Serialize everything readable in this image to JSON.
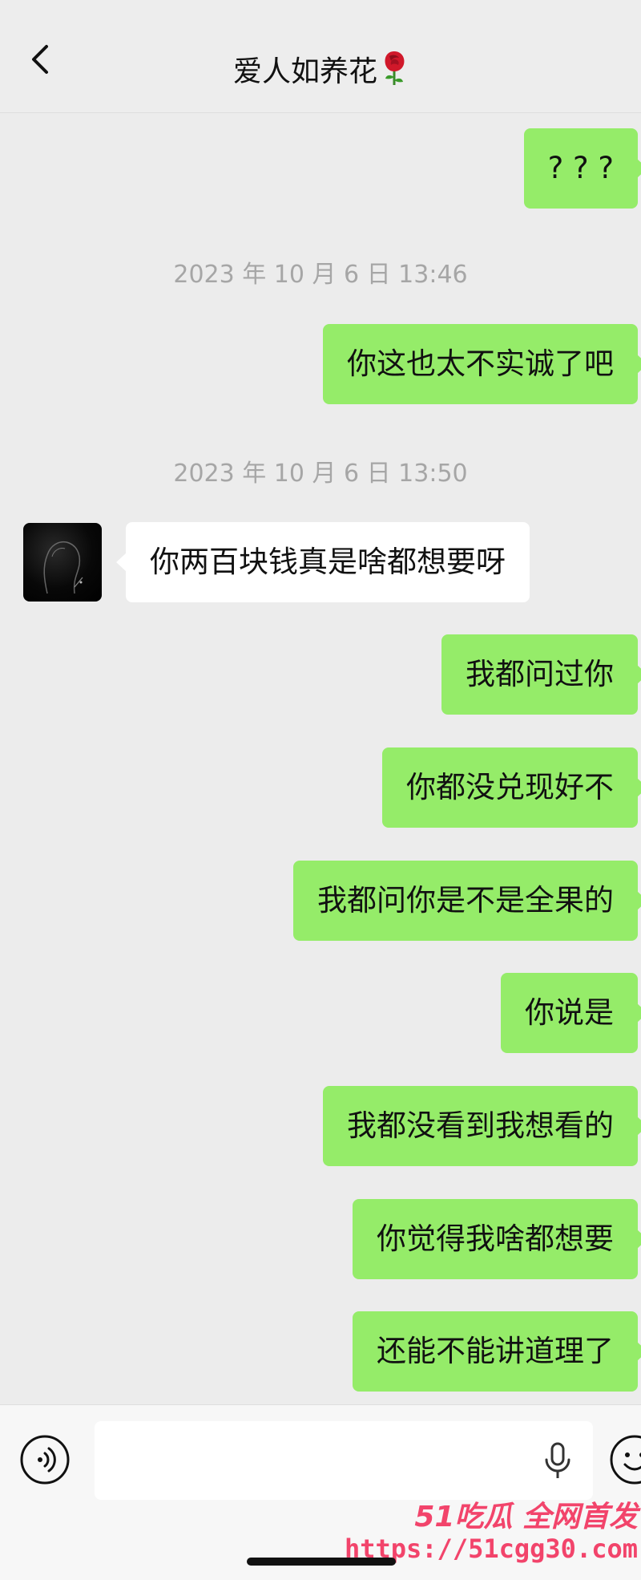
{
  "header": {
    "title": "爱人如养花",
    "title_icon": "rose-icon",
    "back_icon": "chevron-left-icon"
  },
  "messages": [
    {
      "type": "outgoing",
      "text": "? ? ?"
    },
    {
      "type": "time",
      "text": "2023 年 10 月 6 日 13:46"
    },
    {
      "type": "outgoing",
      "text": "你这也太不实诚了吧"
    },
    {
      "type": "time",
      "text": "2023 年 10 月 6 日 13:50"
    },
    {
      "type": "incoming",
      "text": "你两百块钱真是啥都想要呀"
    },
    {
      "type": "outgoing",
      "text": "我都问过你"
    },
    {
      "type": "outgoing",
      "text": "你都没兑现好不"
    },
    {
      "type": "outgoing",
      "text": "我都问你是不是全果的"
    },
    {
      "type": "outgoing",
      "text": "你说是"
    },
    {
      "type": "outgoing",
      "text": "我都没看到我想看的"
    },
    {
      "type": "outgoing",
      "text": "你觉得我啥都想要"
    },
    {
      "type": "outgoing",
      "text": "还能不能讲道理了"
    }
  ],
  "input_bar": {
    "voice_icon": "voice-icon",
    "mic_icon": "microphone-icon",
    "emoji_icon": "emoji-icon",
    "value": ""
  },
  "watermark": {
    "brand": "51吃瓜 全网首发",
    "url": "https://51cgg30.com"
  },
  "colors": {
    "outgoing_bubble": "#95ec69",
    "incoming_bubble": "#ffffff",
    "background": "#ececec",
    "timestamp": "#a6a6a6",
    "watermark": "#f2446b"
  }
}
